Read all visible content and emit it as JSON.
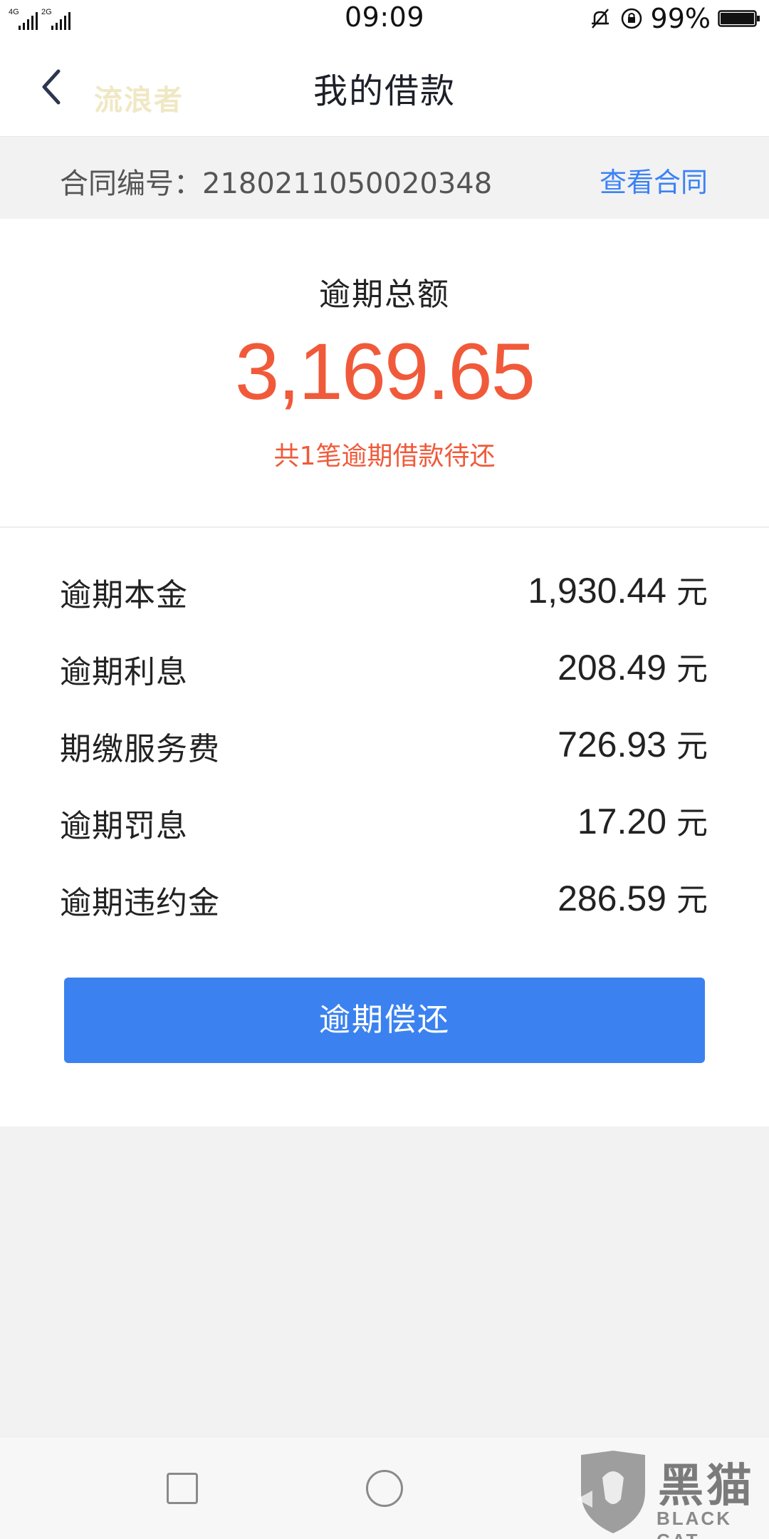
{
  "status_bar": {
    "network_1": "4G",
    "network_2": "2G",
    "time": "09:09",
    "battery_percent": "99%",
    "battery_level": 0.99
  },
  "nav": {
    "title": "我的借款",
    "watermark": "流浪者"
  },
  "contract": {
    "label": "合同编号：2180211050020348",
    "link": "查看合同"
  },
  "summary": {
    "title": "逾期总额",
    "amount": "3,169.65",
    "subtitle": "共1笔逾期借款待还"
  },
  "details": [
    {
      "label": "逾期本金",
      "value": "1,930.44",
      "unit": "元"
    },
    {
      "label": "逾期利息",
      "value": "208.49",
      "unit": "元"
    },
    {
      "label": "期缴服务费",
      "value": "726.93",
      "unit": "元"
    },
    {
      "label": "逾期罚息",
      "value": "17.20",
      "unit": "元"
    },
    {
      "label": "逾期违约金",
      "value": "286.59",
      "unit": "元"
    }
  ],
  "pay_button": "逾期偿还",
  "watermark_logo": {
    "cn": "黑猫",
    "en": "BLACK CAT"
  },
  "colors": {
    "accent_blue": "#3b82f0",
    "amount_red": "#f05a3a"
  }
}
